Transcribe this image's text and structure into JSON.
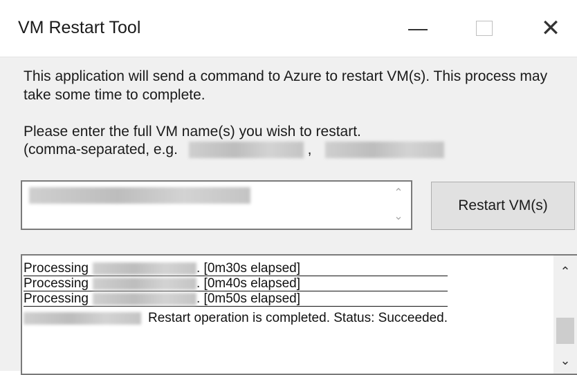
{
  "window": {
    "title": "VM Restart Tool",
    "minimize_symbol": "—",
    "close_symbol": "✕"
  },
  "description": "This application will send a command to Azure to restart VM(s). This process may take some time to complete.",
  "instructions": {
    "line1": "Please enter the full VM name(s) you wish to restart.",
    "line2_prefix": "(comma-separated, e.g.",
    "separator": ","
  },
  "vm_input": {
    "scroll_up_icon": "chevron-up",
    "scroll_down_icon": "chevron-down"
  },
  "restart_button": {
    "label": "Restart VM(s)"
  },
  "log": {
    "lines": [
      {
        "prefix": "Processing",
        "suffix": ". [0m30s elapsed]"
      },
      {
        "prefix": "Processing",
        "suffix": ". [0m40s elapsed]"
      },
      {
        "prefix": "Processing",
        "suffix": ". [0m50s elapsed]"
      },
      {
        "prefix": "",
        "suffix": "Restart operation is completed. Status: Succeeded."
      }
    ],
    "up_arrow": "⌃",
    "down_arrow": "⌄"
  },
  "colors": {
    "window_bg": "#f0f0f0",
    "titlebar_bg": "#ffffff",
    "button_bg": "#e1e1e1",
    "border": "#7a7a7a"
  }
}
